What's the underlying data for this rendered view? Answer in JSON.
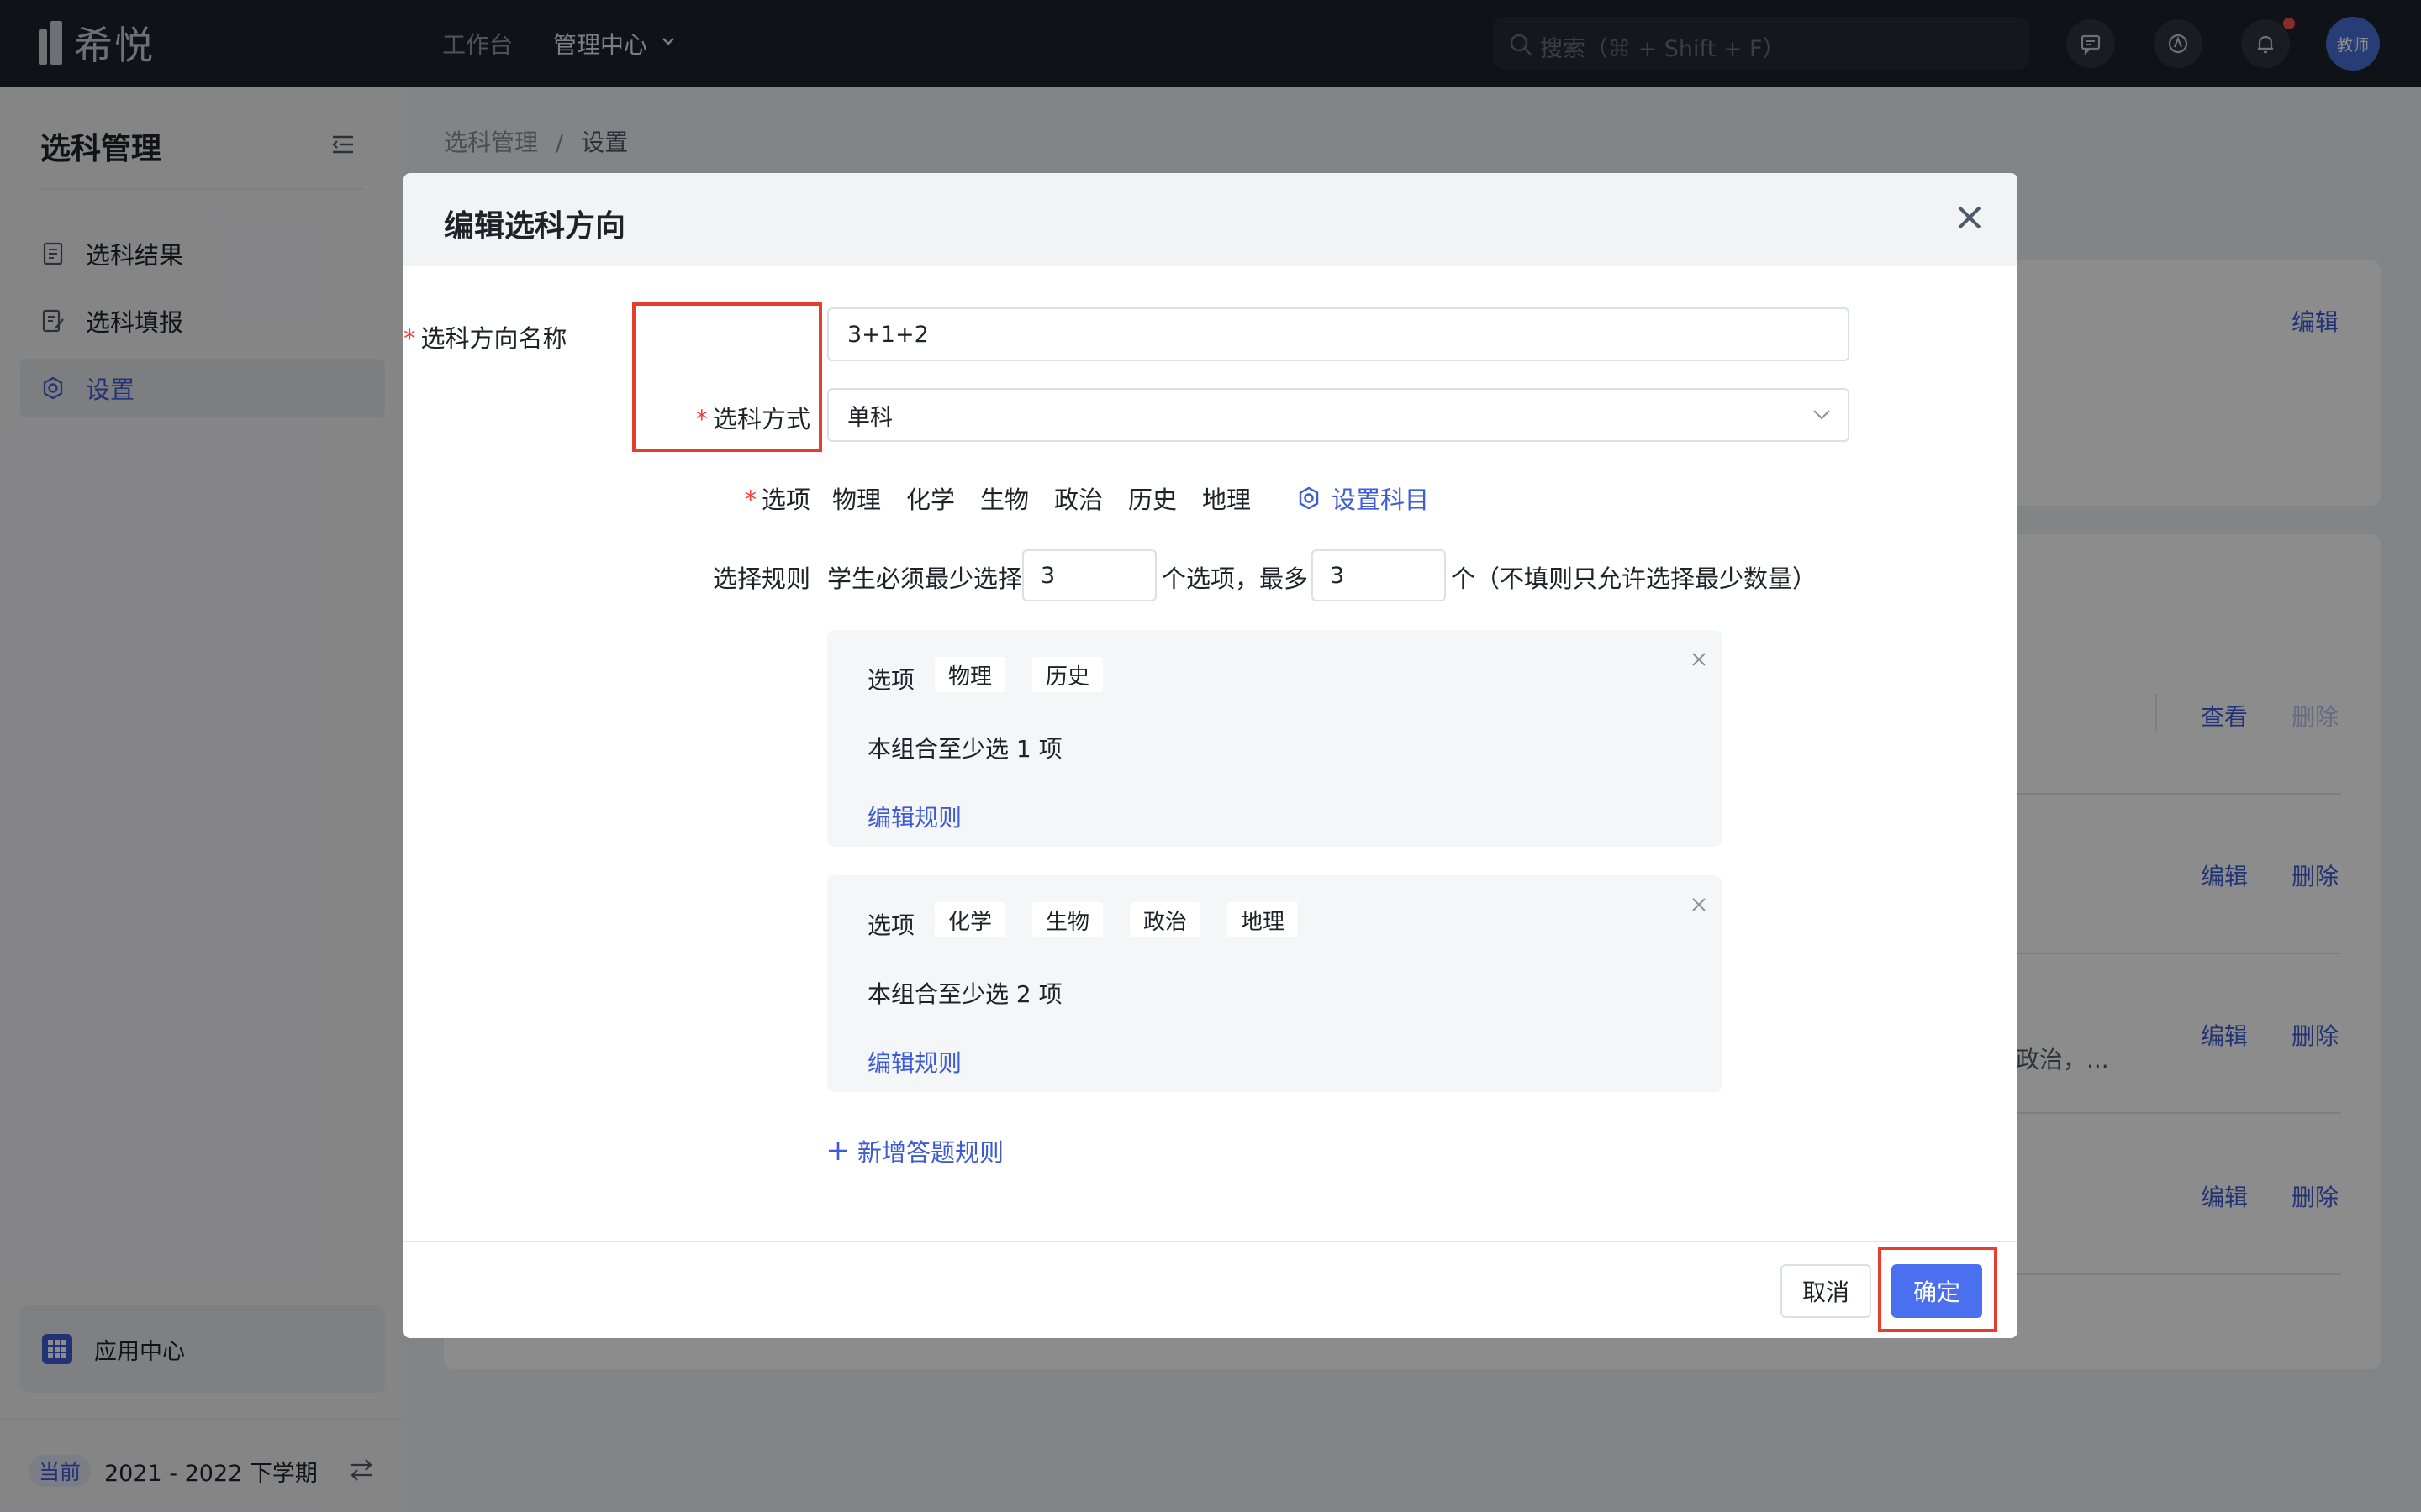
{
  "topbar": {
    "logo_text": "希悦",
    "nav": [
      {
        "label": "工作台"
      },
      {
        "label": "管理中心"
      }
    ],
    "search_placeholder": "搜索（⌘ + Shift + F）",
    "avatar_text": "教师"
  },
  "sidebar": {
    "title": "选科管理",
    "items": [
      {
        "label": "选科结果"
      },
      {
        "label": "选科填报"
      },
      {
        "label": "设置"
      }
    ],
    "app_center": "应用中心",
    "term_badge": "当前",
    "term_text": "2021 - 2022 下学期"
  },
  "background": {
    "breadcrumb_root": "选科管理",
    "breadcrumb_sep": "/",
    "breadcrumb_current": "设置",
    "card1_edit": "编辑",
    "rows": [
      {
        "left": "查看",
        "right": "删除",
        "right_disabled": true
      },
      {
        "left": "编辑",
        "right": "删除",
        "right_disabled": false
      },
      {
        "left": "编辑",
        "right": "删除",
        "right_disabled": false
      },
      {
        "left": "编辑",
        "right": "删除",
        "right_disabled": false
      }
    ],
    "row3_text": "政治，..."
  },
  "modal": {
    "title": "编辑选科方向",
    "field_name": {
      "label": "选科方向名称",
      "value": "3+1+2"
    },
    "field_mode": {
      "label": "选科方式",
      "value": "单科"
    },
    "field_options": {
      "label": "选项",
      "subjects": [
        "物理",
        "化学",
        "生物",
        "政治",
        "历史",
        "地理"
      ],
      "set_subject": "设置科目"
    },
    "rule": {
      "label": "选择规则",
      "text_a": "学生必须最少选择",
      "min": "3",
      "text_b": "个选项，最多",
      "max": "3",
      "text_c": "个（不填则只允许选择最少数量）"
    },
    "groups": [
      {
        "label": "选项",
        "chips": [
          "物理",
          "历史"
        ],
        "min_text": "本组合至少选 1 项",
        "edit": "编辑规则"
      },
      {
        "label": "选项",
        "chips": [
          "化学",
          "生物",
          "政治",
          "地理"
        ],
        "min_text": "本组合至少选 2 项",
        "edit": "编辑规则"
      }
    ],
    "add_rule": "新增答题规则",
    "cancel": "取消",
    "ok": "确定"
  }
}
